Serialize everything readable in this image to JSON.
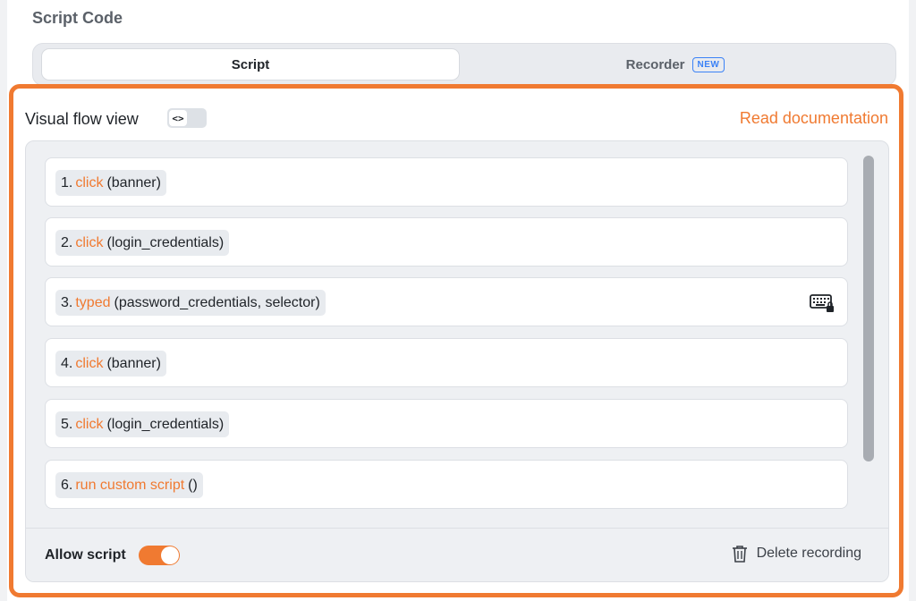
{
  "section": {
    "title": "Script Code"
  },
  "tabs": {
    "script_label": "Script",
    "recorder_label": "Recorder",
    "recorder_badge": "NEW"
  },
  "flow": {
    "title": "Visual flow view",
    "toggle_icon": "code-icon",
    "doc_link": "Read documentation",
    "steps": [
      {
        "num": "1.",
        "action": "click",
        "args": "(banner)"
      },
      {
        "num": "2.",
        "action": "click",
        "args": "(login_credentials)"
      },
      {
        "num": "3.",
        "action": "typed",
        "args": "(password_credentials, selector)",
        "icon": "keyboard-lock-icon"
      },
      {
        "num": "4.",
        "action": "click",
        "args": "(banner)"
      },
      {
        "num": "5.",
        "action": "click",
        "args": "(login_credentials)"
      },
      {
        "num": "6.",
        "action": "run custom script",
        "args": "()"
      }
    ]
  },
  "footer": {
    "allow_script_label": "Allow script",
    "allow_script_on": true,
    "delete_label": "Delete recording"
  },
  "colors": {
    "accent": "#f07a31",
    "badge": "#3b82f6"
  }
}
